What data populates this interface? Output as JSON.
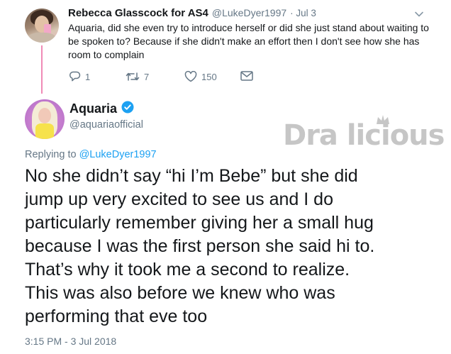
{
  "reply_tweet": {
    "author_name": "Rebecca Glasscock for AS4",
    "author_handle": "@LukeDyer1997",
    "date": "· Jul 3",
    "text": "Aquaria, did she even try to introduce herself or did she just stand about waiting to be spoken to? Because if she didn't make an effort then I don't see how she has room to complain",
    "actions": {
      "reply_count": "1",
      "retweet_count": "7",
      "like_count": "150"
    }
  },
  "main_tweet": {
    "author_name": "Aquaria",
    "author_handle": "@aquariaofficial",
    "verified": true,
    "replying_to_label": "Replying to",
    "replying_to_handle": "@LukeDyer1997",
    "lines": [
      "No she didn’t say “hi I’m Bebe” but she did",
      "jump up very excited to see us and I do",
      "particularly remember giving her a small hug",
      "because I was the first person she said hi to.",
      "That’s why it took me a second to realize.",
      "This was also before we knew who was",
      "performing that eve too"
    ],
    "timestamp": "3:15 PM - 3 Jul 2018"
  },
  "watermark": {
    "text": "Dra licious"
  },
  "colors": {
    "thread_line": "#f08bb6",
    "link": "#1da1f2",
    "verified": "#1da1f2",
    "muted": "#657786"
  },
  "icons": {
    "reply": "reply-icon",
    "retweet": "retweet-icon",
    "like": "heart-icon",
    "dm": "envelope-icon",
    "more": "chevron-down-icon"
  }
}
